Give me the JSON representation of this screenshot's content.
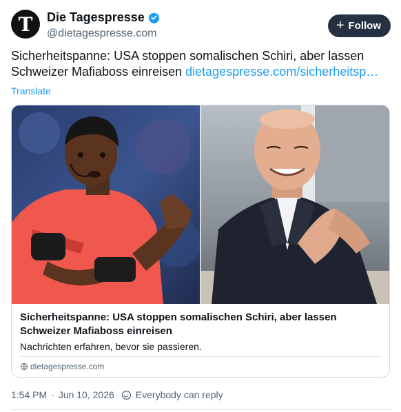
{
  "author": {
    "avatar_letter": "T",
    "display_name": "Die Tagespresse",
    "verified_icon": "verified-badge-icon",
    "handle": "@dietagespresse.com"
  },
  "follow": {
    "label": "Follow",
    "icon": "plus-icon"
  },
  "post": {
    "text": "Sicherheitspanne: USA stoppen somalischen Schiri, aber lassen Schweizer Mafiaboss einreisen",
    "link": "dietagespresse.com/sicherheitsp…",
    "translate_label": "Translate"
  },
  "card": {
    "title": "Sicherheitspanne: USA stoppen somalischen Schiri, aber lassen Schweizer Mafiaboss einreisen",
    "description": "Nachrichten erfahren, bevor sie passieren.",
    "domain": "dietagespresse.com"
  },
  "meta": {
    "time": "1:54 PM",
    "separator": "·",
    "date": "Jun 10, 2026",
    "reply_setting": "Everybody can reply"
  },
  "colors": {
    "link": "#1d9bf0",
    "text": "#0f1419",
    "muted": "#536471",
    "follow_bg": "#253040",
    "border": "#cfd9de"
  }
}
